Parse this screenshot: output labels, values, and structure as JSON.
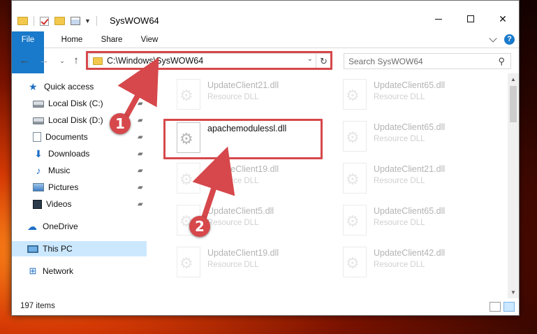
{
  "window": {
    "title": "SysWOW64",
    "controls": {
      "minimize": "",
      "maximize": "",
      "close": "✕"
    }
  },
  "ribbon": {
    "tabs": [
      "File",
      "Home",
      "Share",
      "View"
    ]
  },
  "nav": {
    "back": "←",
    "forward": "→",
    "recent": "⌄",
    "up": "↑",
    "address": "C:\\Windows\\SysWOW64",
    "address_dropdown": "⌄",
    "refresh": "↻",
    "search_placeholder": "Search SysWOW64",
    "search_icon": "⚲"
  },
  "sidebar": {
    "items": [
      {
        "label": "Quick access",
        "icon": "star-icon",
        "pinned": false
      },
      {
        "label": "Local Disk (C:)",
        "icon": "disk-icon",
        "pinned": true
      },
      {
        "label": "Local Disk (D:)",
        "icon": "disk-icon",
        "pinned": true
      },
      {
        "label": "Documents",
        "icon": "documents-icon",
        "pinned": true
      },
      {
        "label": "Downloads",
        "icon": "download-icon",
        "pinned": true
      },
      {
        "label": "Music",
        "icon": "music-icon",
        "pinned": true
      },
      {
        "label": "Pictures",
        "icon": "pictures-icon",
        "pinned": true
      },
      {
        "label": "Videos",
        "icon": "videos-icon",
        "pinned": true
      },
      {
        "label": "OneDrive",
        "icon": "cloud-icon",
        "pinned": false
      },
      {
        "label": "This PC",
        "icon": "computer-icon",
        "pinned": false
      },
      {
        "label": "Network",
        "icon": "network-icon",
        "pinned": false
      }
    ],
    "pin_glyph": "📌"
  },
  "files": {
    "highlighted": {
      "name": "apachemodulessl.dll"
    },
    "ghost_left": [
      {
        "name": "UpdateClient21.dll",
        "type": "Resource DLL"
      },
      {
        "name": "UpdateClient19.dll",
        "type": "Resource DLL"
      },
      {
        "name": "UpdateClient5.dll",
        "type": "Resource DLL"
      },
      {
        "name": "UpdateClient19.dll",
        "type": "Resource DLL"
      }
    ],
    "ghost_right": [
      {
        "name": "UpdateClient65.dll",
        "type": "Resource DLL"
      },
      {
        "name": "UpdateClient65.dll",
        "type": "Resource DLL"
      },
      {
        "name": "UpdateClient21.dll",
        "type": "Resource DLL"
      },
      {
        "name": "UpdateClient65.dll",
        "type": "Resource DLL"
      },
      {
        "name": "UpdateClient42.dll",
        "type": "Resource DLL"
      }
    ]
  },
  "status": {
    "item_count": "197 items"
  },
  "annotations": {
    "step1": "1",
    "step2": "2",
    "color": "#d6484b"
  }
}
